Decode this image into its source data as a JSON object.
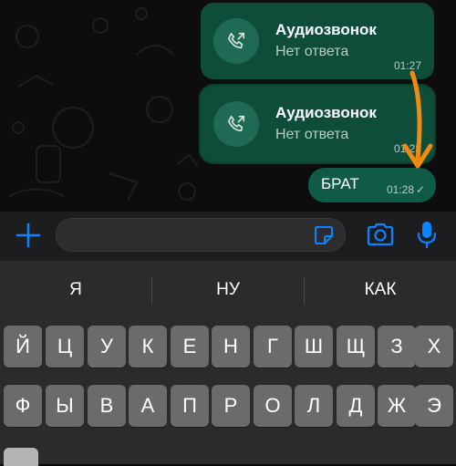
{
  "chat": {
    "call_messages": [
      {
        "title": "Аудиозвонок",
        "status": "Нет ответа",
        "time": "01:27"
      },
      {
        "title": "Аудиозвонок",
        "status": "Нет ответа",
        "time": "01:28"
      }
    ],
    "text_message": {
      "text": "БРАТ",
      "time": "01:28",
      "check": "✓"
    }
  },
  "input_bar": {
    "plus_icon": "plus-icon",
    "sticker_icon": "sticker-icon",
    "camera_icon": "camera-icon",
    "mic_icon": "microphone-icon",
    "accent_color": "#0a84ff"
  },
  "keyboard": {
    "suggestions": [
      "Я",
      "НУ",
      "КАК"
    ],
    "row1": [
      "Й",
      "Ц",
      "У",
      "К",
      "Е",
      "Н",
      "Г",
      "Ш",
      "Щ",
      "З",
      "Х"
    ],
    "row2": [
      "Ф",
      "Ы",
      "В",
      "А",
      "П",
      "Р",
      "О",
      "Л",
      "Д",
      "Ж",
      "Э"
    ]
  },
  "colors": {
    "bubble": "#0f4d3b",
    "annotation_arrow": "#f08a10"
  }
}
